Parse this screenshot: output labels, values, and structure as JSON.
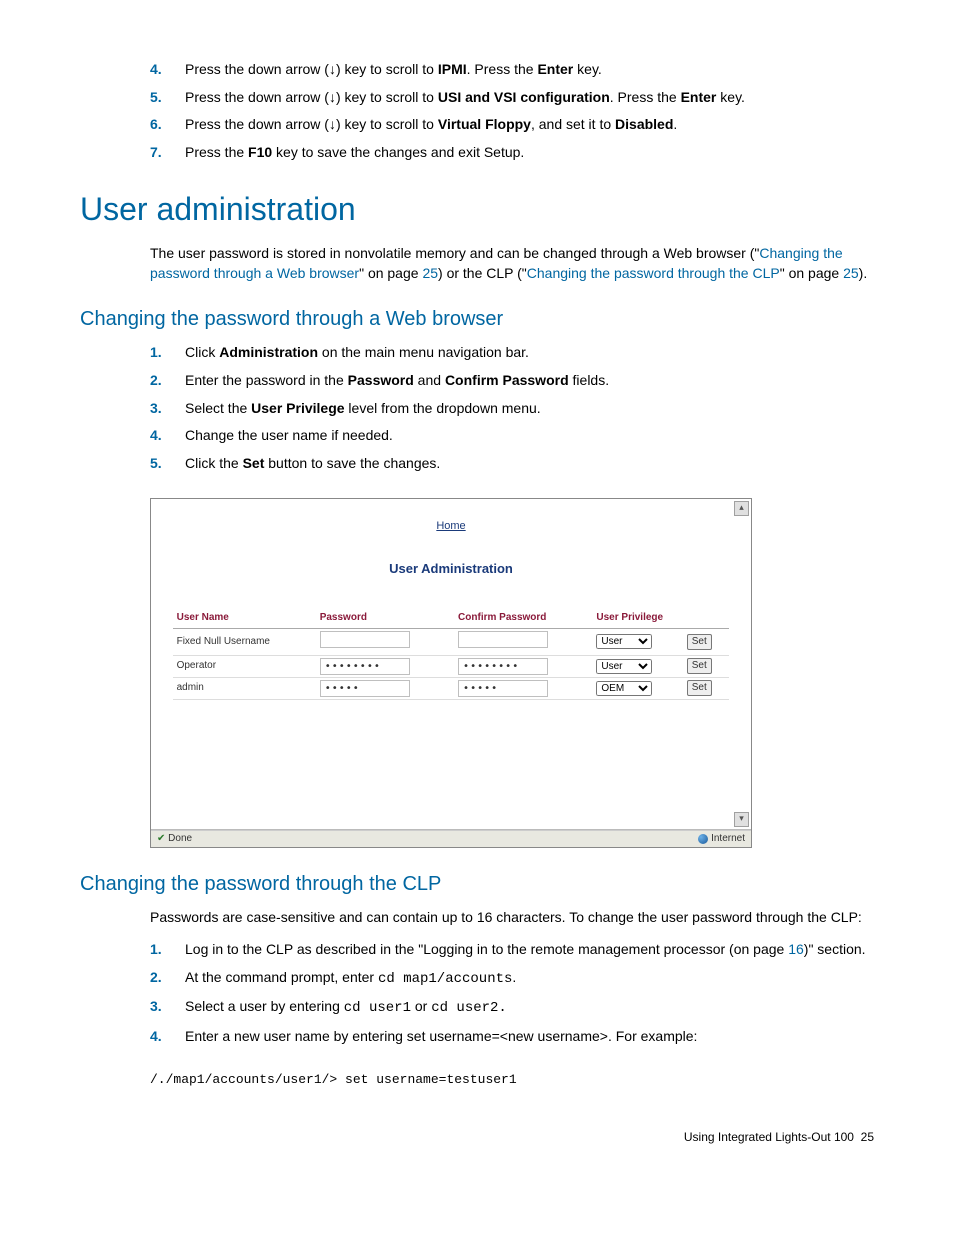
{
  "steps_top": [
    {
      "n": "4.",
      "pre": "Press the down arrow (↓) key to scroll to ",
      "b1": "IPMI",
      "mid": ". Press the ",
      "b2": "Enter",
      "post": " key."
    },
    {
      "n": "5.",
      "pre": "Press the down arrow (↓) key to scroll to ",
      "b1": "USI and VSI configuration",
      "mid": ". Press the ",
      "b2": "Enter",
      "post": " key."
    },
    {
      "n": "6.",
      "pre": "Press the down arrow (↓) key to scroll to ",
      "b1": "Virtual Floppy",
      "mid": ", and set it to ",
      "b2": "Disabled",
      "post": "."
    },
    {
      "n": "7.",
      "pre": "Press the ",
      "b1": "F10",
      "mid": " key to save the changes and exit Setup.",
      "b2": "",
      "post": ""
    }
  ],
  "h1": "User administration",
  "intro": {
    "pre": "The user password is stored in nonvolatile memory and can be changed through a Web browser (\"",
    "link1": "Changing the password through a Web browser",
    "mid1": "\" on page ",
    "page1": "25",
    "mid2": ") or the CLP (\"",
    "link2": "Changing the password through the CLP",
    "mid3": "\" on page ",
    "page2": "25",
    "post": ")."
  },
  "h2a": "Changing the password through a Web browser",
  "steps_a": [
    {
      "n": "1.",
      "pre": "Click ",
      "b1": "Administration",
      "post": " on the main menu navigation bar."
    },
    {
      "n": "2.",
      "pre": "Enter the password in the ",
      "b1": "Password",
      "mid": " and ",
      "b2": "Confirm Password",
      "post": " fields."
    },
    {
      "n": "3.",
      "pre": "Select the ",
      "b1": "User Privilege",
      "post": " level from the dropdown menu."
    },
    {
      "n": "4.",
      "pre": "Change the user name if needed.",
      "b1": "",
      "post": ""
    },
    {
      "n": "5.",
      "pre": "Click the ",
      "b1": "Set",
      "post": " button to save the changes."
    }
  ],
  "shot": {
    "home": "Home",
    "title": "User Administration",
    "headers": [
      "User Name",
      "Password",
      "Confirm Password",
      "User Privilege"
    ],
    "rows": [
      {
        "name": "Fixed Null Username",
        "pw": "",
        "cpw": "",
        "priv": "User",
        "set": "Set"
      },
      {
        "name": "Operator",
        "pw": "••••••••",
        "cpw": "••••••••",
        "priv": "User",
        "set": "Set"
      },
      {
        "name": "admin",
        "pw": "•••••",
        "cpw": "•••••",
        "priv": "OEM",
        "set": "Set"
      }
    ],
    "done": "Done",
    "internet": "Internet"
  },
  "h2b": "Changing the password through the CLP",
  "clp_intro": "Passwords are case-sensitive and can contain up to 16 characters. To change the user password through the CLP:",
  "steps_b": [
    {
      "n": "1.",
      "pre": "Log in to the CLP as described in the \"Logging in to the remote management processor (on page ",
      "link": "16",
      "post": ")\" section."
    },
    {
      "n": "2.",
      "pre": "At the command prompt, enter ",
      "code": "cd map1/accounts",
      "post": "."
    },
    {
      "n": "3.",
      "pre": "Select a user by entering ",
      "code": "cd user1",
      "mid": " or ",
      "code2": "cd user2.",
      "post": ""
    },
    {
      "n": "4.",
      "pre": "Enter a new user name by entering set username=<new username>. For example:",
      "code": "",
      "post": ""
    }
  ],
  "codeline": "/./map1/accounts/user1/> set username=testuser1",
  "footer": {
    "text": "Using Integrated Lights-Out 100",
    "page": "25"
  }
}
